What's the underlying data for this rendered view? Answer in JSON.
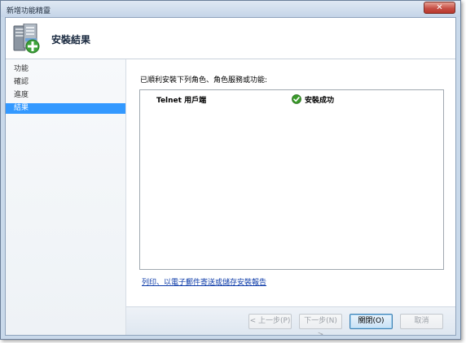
{
  "window": {
    "title": "新增功能精靈",
    "close_glyph": "✕"
  },
  "banner": {
    "title": "安裝結果",
    "icon": "server-add-icon"
  },
  "nav": {
    "items": [
      {
        "label": "功能",
        "active": false
      },
      {
        "label": "確認",
        "active": false
      },
      {
        "label": "進度",
        "active": false
      },
      {
        "label": "結果",
        "active": true
      }
    ]
  },
  "main": {
    "intro": "已順利安裝下列角色、角色服務或功能:",
    "results": [
      {
        "feature": "Telnet 用戶端",
        "status": "安裝成功",
        "status_icon": "success-check-icon"
      }
    ],
    "report_link": "列印、以電子郵件寄送或儲存安裝報告"
  },
  "footer": {
    "back": "< 上一步(P)",
    "next": "下一步(N) >",
    "close": "關閉(O)",
    "cancel": "取消"
  },
  "colors": {
    "nav_active": "#3399ff",
    "success": "#3a9a2a",
    "link": "#0b3aa8"
  }
}
